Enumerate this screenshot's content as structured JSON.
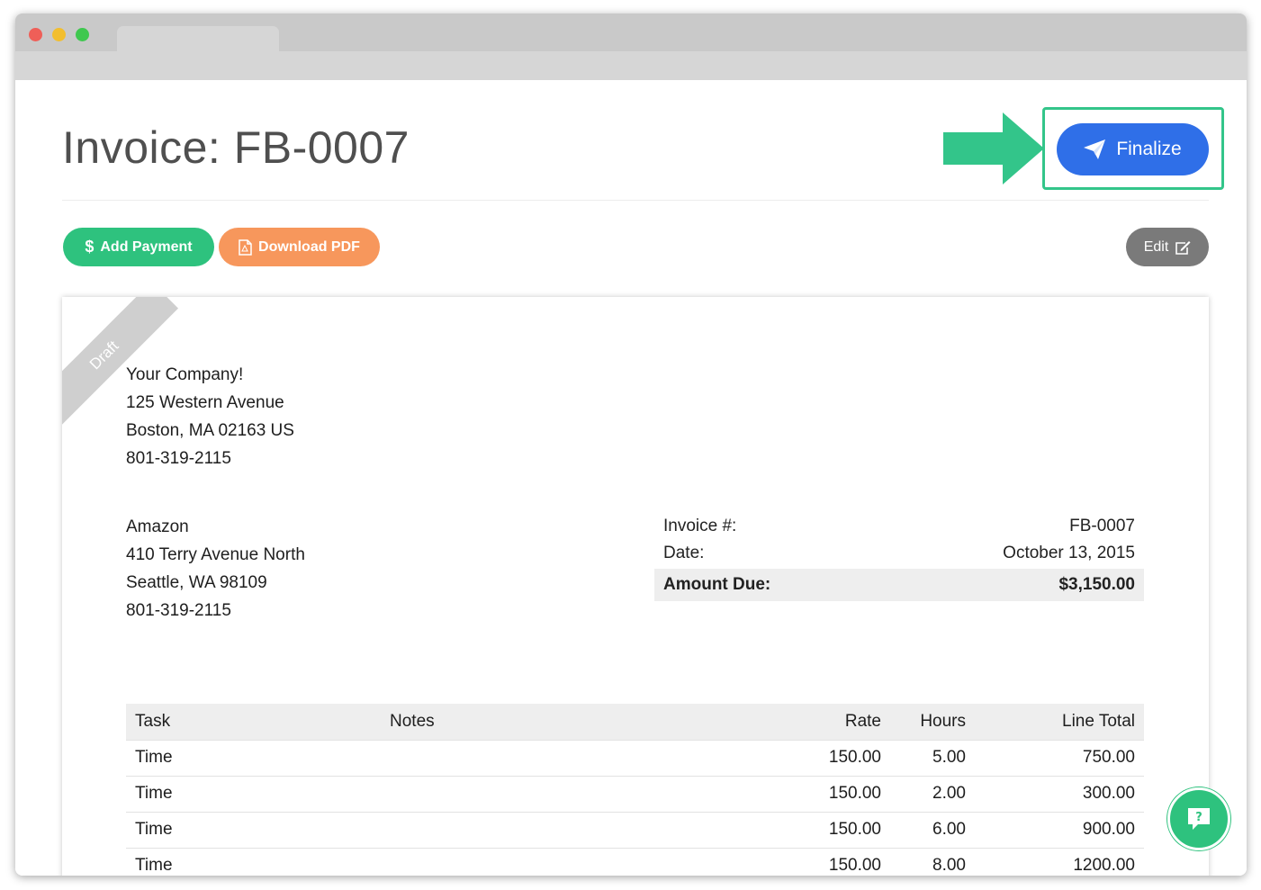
{
  "page": {
    "title": "Invoice: FB-0007"
  },
  "actions": {
    "finalize_label": "Finalize",
    "add_payment_label": "Add Payment",
    "download_pdf_label": "Download PDF",
    "edit_label": "Edit"
  },
  "invoice": {
    "ribbon": "Draft",
    "company": {
      "name": "Your Company!",
      "street": "125 Western Avenue",
      "city": "Boston, MA 02163 US",
      "phone": "801-319-2115"
    },
    "client": {
      "name": "Amazon",
      "street": "410 Terry Avenue North",
      "city": "Seattle, WA 98109",
      "phone": "801-319-2115"
    },
    "meta": {
      "number_label": "Invoice #:",
      "number_value": "FB-0007",
      "date_label": "Date:",
      "date_value": "October 13, 2015",
      "due_label": "Amount Due:",
      "due_value": "$3,150.00"
    },
    "table": {
      "headers": {
        "task": "Task",
        "notes": "Notes",
        "rate": "Rate",
        "hours": "Hours",
        "total": "Line Total"
      },
      "rows": [
        {
          "task": "Time",
          "notes": "",
          "rate": "150.00",
          "hours": "5.00",
          "total": "750.00"
        },
        {
          "task": "Time",
          "notes": "",
          "rate": "150.00",
          "hours": "2.00",
          "total": "300.00"
        },
        {
          "task": "Time",
          "notes": "",
          "rate": "150.00",
          "hours": "6.00",
          "total": "900.00"
        },
        {
          "task": "Time",
          "notes": "",
          "rate": "150.00",
          "hours": "8.00",
          "total": "1200.00"
        }
      ]
    }
  },
  "help": {
    "glyph": "?"
  },
  "colors": {
    "finalize": "#2f6fe8",
    "highlight": "#33c58a",
    "add_payment": "#2ec27e",
    "download_pdf": "#f7975c",
    "edit": "#7a7a7a"
  }
}
